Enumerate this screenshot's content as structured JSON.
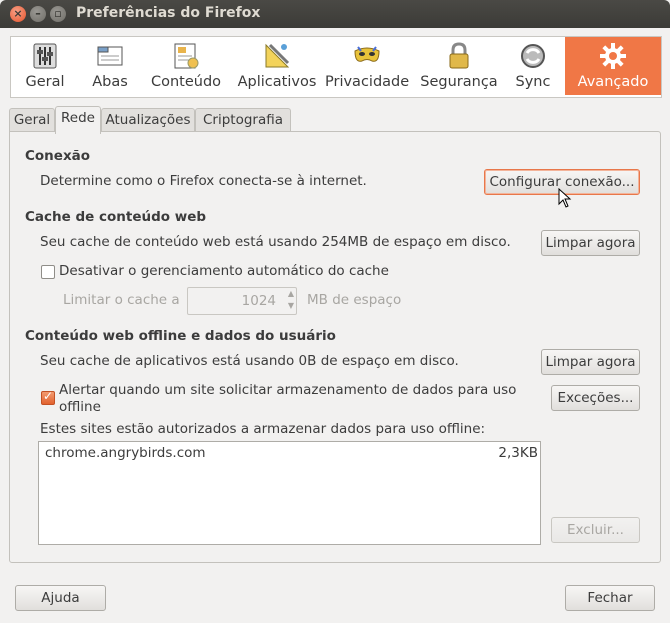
{
  "window": {
    "title": "Preferências do Firefox"
  },
  "toolbar": {
    "items": [
      {
        "label": "Geral",
        "icon": "sliders-icon"
      },
      {
        "label": "Abas",
        "icon": "tabs-icon"
      },
      {
        "label": "Conteúdo",
        "icon": "content-icon"
      },
      {
        "label": "Aplicativos",
        "icon": "applications-icon"
      },
      {
        "label": "Privacidade",
        "icon": "mask-icon"
      },
      {
        "label": "Segurança",
        "icon": "lock-icon"
      },
      {
        "label": "Sync",
        "icon": "sync-icon"
      },
      {
        "label": "Avançado",
        "icon": "gear-icon"
      }
    ],
    "active": "Avançado",
    "accent": "#f07746"
  },
  "subtabs": [
    "Geral",
    "Rede",
    "Atualizações",
    "Criptografia"
  ],
  "subtabs_selected": "Rede",
  "connection": {
    "heading": "Conexão",
    "text": "Determine como o Firefox conecta-se à internet.",
    "button": "Configurar conexão..."
  },
  "cache": {
    "heading": "Cache de conteúdo web",
    "text": "Seu cache de conteúdo web está usando 254MB de espaço em disco.",
    "clear_button": "Limpar agora",
    "override_label": "Desativar o gerenciamento automático do cache",
    "override_checked": false,
    "limit_label": "Limitar o cache a",
    "limit_value": "1024",
    "limit_unit": "MB de espaço"
  },
  "offline": {
    "heading": "Conteúdo web offline e dados do usuário",
    "text": "Seu cache de aplicativos está usando 0B de espaço em disco.",
    "clear_button": "Limpar agora",
    "warn_label_1": "Alertar quando um site solicitar armazenamento de dados para uso",
    "warn_label_2": "offline",
    "warn_checked": true,
    "exceptions_button": "Exceções...",
    "sites_label": "Estes sites estão autorizados a armazenar dados para uso offline:",
    "sites": [
      {
        "name": "chrome.angrybirds.com",
        "size": "2,3KB"
      }
    ],
    "remove_button": "Excluir..."
  },
  "footer": {
    "help_button": "Ajuda",
    "close_button": "Fechar"
  }
}
